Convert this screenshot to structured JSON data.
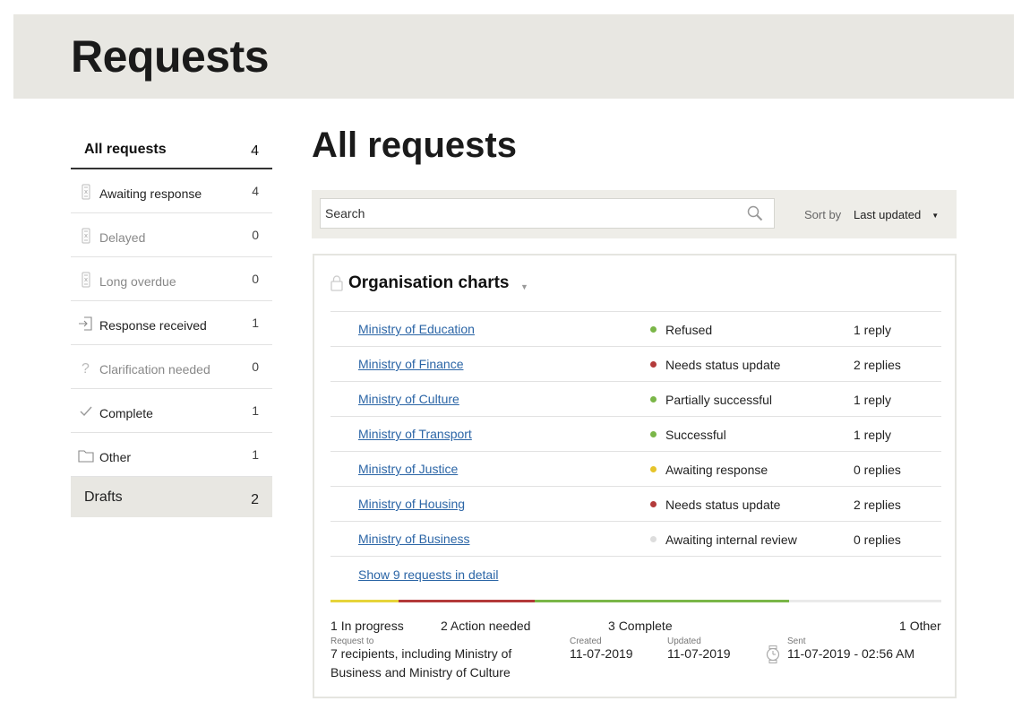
{
  "page": {
    "title": "Requests"
  },
  "sidebar": {
    "header": {
      "label": "All requests",
      "count": "4"
    },
    "items": [
      {
        "label": "Awaiting response",
        "count": "4",
        "icon": "hourglass-icon",
        "muted": false
      },
      {
        "label": "Delayed",
        "count": "0",
        "icon": "hourglass-icon",
        "muted": true
      },
      {
        "label": "Long overdue",
        "count": "0",
        "icon": "hourglass-icon",
        "muted": true
      },
      {
        "label": "Response received",
        "count": "1",
        "icon": "inbox-arrow-icon",
        "muted": false
      },
      {
        "label": "Clarification needed",
        "count": "0",
        "icon": "question-icon",
        "muted": true
      },
      {
        "label": "Complete",
        "count": "1",
        "icon": "checkmark-icon",
        "muted": false
      },
      {
        "label": "Other",
        "count": "1",
        "icon": "folder-icon",
        "muted": false
      }
    ],
    "drafts": {
      "label": "Drafts",
      "count": "2"
    }
  },
  "main": {
    "title": "All requests",
    "search": {
      "placeholder": "Search",
      "value": ""
    },
    "sort": {
      "label": "Sort by",
      "value": "Last updated"
    }
  },
  "card": {
    "title": "Organisation charts",
    "rows": [
      {
        "name": "Ministry of Education",
        "status": "Refused",
        "status_color": "#7ab648",
        "replies": "1 reply"
      },
      {
        "name": "Ministry of Finance",
        "status": "Needs status update",
        "status_color": "#b33a3a",
        "replies": "2 replies"
      },
      {
        "name": "Ministry of Culture",
        "status": "Partially successful",
        "status_color": "#7ab648",
        "replies": "1 reply"
      },
      {
        "name": "Ministry of Transport",
        "status": "Successful",
        "status_color": "#7ab648",
        "replies": "1 reply"
      },
      {
        "name": "Ministry of Justice",
        "status": "Awaiting response",
        "status_color": "#e6c42a",
        "replies": "0 replies"
      },
      {
        "name": "Ministry of Housing",
        "status": "Needs status update",
        "status_color": "#b33a3a",
        "replies": "2 replies"
      },
      {
        "name": "Ministry of Business",
        "status": "Awaiting internal review",
        "status_color": "#dddddd",
        "replies": "0 replies"
      }
    ],
    "show_link": "Show 9 requests in detail",
    "colors": {
      "in_progress": "#e6d43a",
      "action_needed": "#b33a3a",
      "complete": "#7ab648",
      "other": "#eaeaea"
    },
    "summary": {
      "in_progress": {
        "num": "1",
        "label": "In progress",
        "fraction": 0.1111
      },
      "action_needed": {
        "num": "2",
        "label": "Action needed",
        "fraction": 0.2222
      },
      "complete": {
        "num": "3",
        "label": "Complete",
        "fraction": 0.4167
      },
      "other": {
        "num": "1",
        "label": "Other",
        "fraction": 0.1111
      }
    },
    "meta": {
      "request_to_label": "Request to",
      "request_to_value": "7 recipients, including Ministry of Business and Ministry of Culture",
      "created_label": "Created",
      "created_value": "11-07-2019",
      "updated_label": "Updated",
      "updated_value": "11-07-2019",
      "sent_label": "Sent",
      "sent_value": "11-07-2019 - 02:56 AM"
    }
  }
}
